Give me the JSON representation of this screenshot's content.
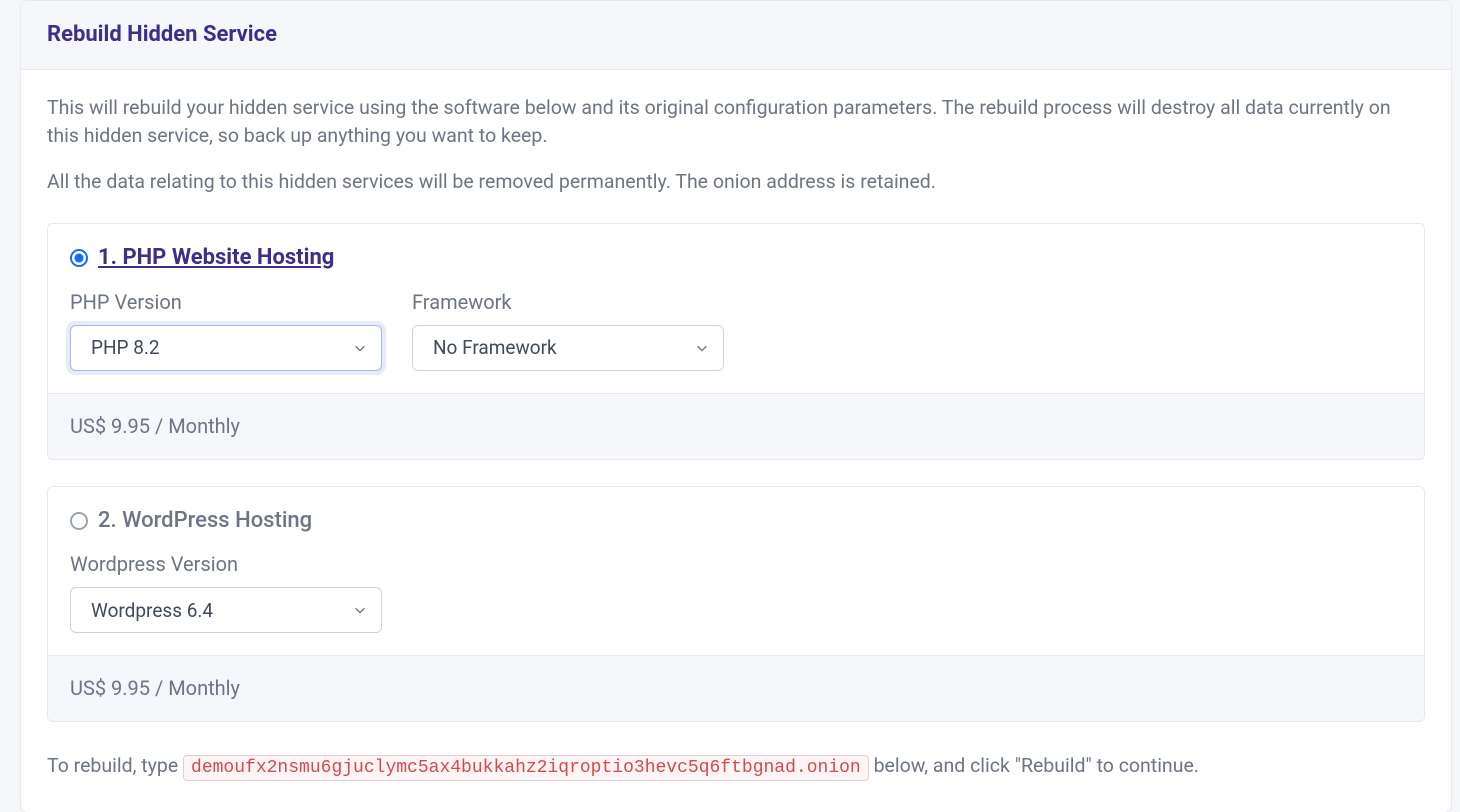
{
  "header": {
    "title": "Rebuild Hidden Service"
  },
  "intro": {
    "p1": "This will rebuild your hidden service using the software below and its original configuration parameters. The rebuild process will destroy all data currently on this hidden service, so back up anything you want to keep.",
    "p2": "All the data relating to this hidden services will be removed permanently. The onion address is retained."
  },
  "options": [
    {
      "selected": true,
      "title": "1. PHP Website Hosting",
      "controls": [
        {
          "label": "PHP Version",
          "value": "PHP 8.2",
          "focused": true
        },
        {
          "label": "Framework",
          "value": "No Framework",
          "focused": false
        }
      ],
      "price": "US$ 9.95 / Monthly"
    },
    {
      "selected": false,
      "title": "2. WordPress Hosting",
      "controls": [
        {
          "label": "Wordpress Version",
          "value": "Wordpress 6.4",
          "focused": false
        }
      ],
      "price": "US$ 9.95 / Monthly"
    }
  ],
  "confirm": {
    "prefix": "To rebuild, type ",
    "onion": "demoufx2nsmu6gjuclymc5ax4bukkahz2iqroptio3hevc5q6ftbgnad.onion",
    "suffix": " below, and click \"Rebuild\" to continue."
  }
}
